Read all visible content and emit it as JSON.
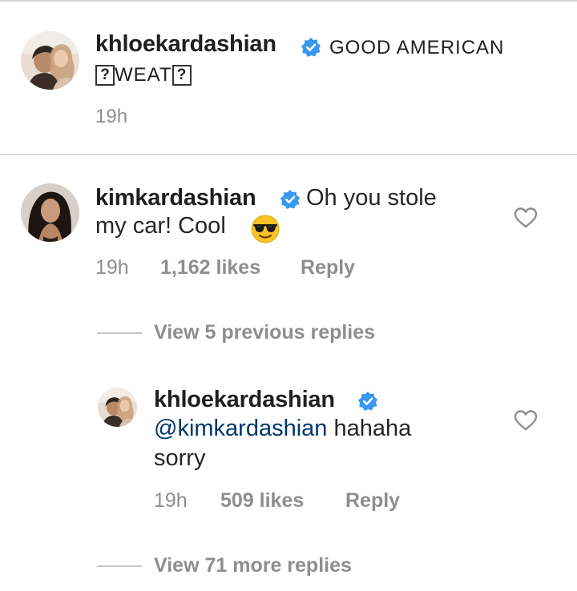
{
  "colors": {
    "verified_badge": "#3897f0",
    "meta_text": "#8e8e8e",
    "mention": "#00376b",
    "divider": "#dbdbdb"
  },
  "caption": {
    "username": "khloekardashian",
    "text_line1": "GOOD AMERICAN",
    "text_line2_box_left": "?",
    "text_line2_word": "WEAT",
    "text_line2_box_right": "?",
    "time": "19h",
    "avatar_icon": "profile-photo",
    "verified_icon": "verified-badge"
  },
  "comment": {
    "username": "kimkardashian",
    "text_line1": "Oh you stole",
    "text_line2": "my car! Cool",
    "emoji": "smiling-face-with-sunglasses",
    "time": "19h",
    "likes": "1,162 likes",
    "reply_label": "Reply",
    "like_icon": "heart-outline"
  },
  "view_previous": {
    "label": "View 5 previous replies"
  },
  "reply": {
    "username": "khloekardashian",
    "mention": "@kimkardashian",
    "text_after_mention": "hahaha",
    "text_line2": "sorry",
    "time": "19h",
    "likes": "509 likes",
    "reply_label": "Reply",
    "like_icon": "heart-outline"
  },
  "view_more": {
    "label": "View 71 more replies"
  }
}
